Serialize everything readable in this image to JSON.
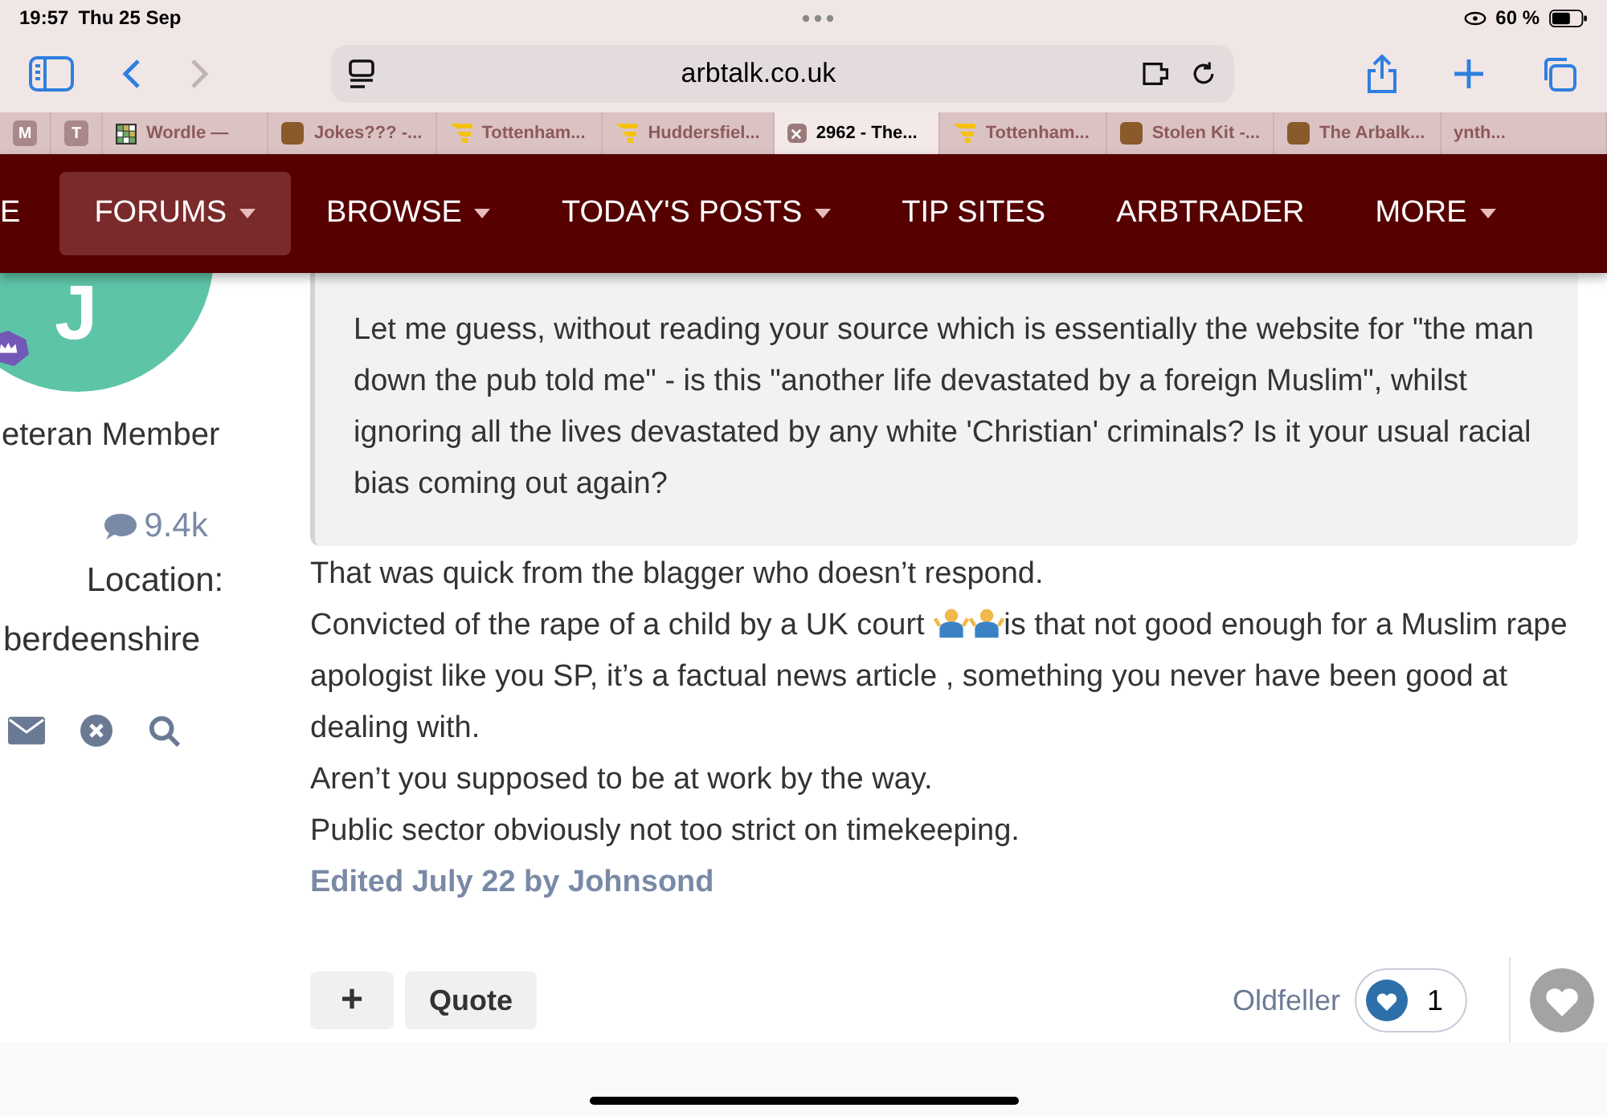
{
  "status_bar": {
    "time": "19:57",
    "date": "Thu 25 Sep",
    "battery": "60 %"
  },
  "browser": {
    "url": "arbtalk.co.uk"
  },
  "tabs": [
    {
      "kind": "letter",
      "letter": "M",
      "selected": false
    },
    {
      "kind": "letter",
      "letter": "T",
      "selected": false
    },
    {
      "kind": "grid",
      "label": "Wordle —",
      "selected": false
    },
    {
      "kind": "avatar",
      "label": "Jokes??? -...",
      "selected": false
    },
    {
      "kind": "flag",
      "label": "Tottenham...",
      "selected": false
    },
    {
      "kind": "flag",
      "label": "Huddersfiel...",
      "selected": false
    },
    {
      "kind": "close",
      "label": "2962 - The...",
      "selected": true
    },
    {
      "kind": "flag",
      "label": "Tottenham...",
      "selected": false
    },
    {
      "kind": "avatar",
      "label": "Stolen Kit -...",
      "selected": false
    },
    {
      "kind": "avatar",
      "label": "The Arbalk...",
      "selected": false
    },
    {
      "kind": "plain",
      "label": "ynth...",
      "selected": false
    }
  ],
  "nav": [
    {
      "label": "E",
      "dropdown": false,
      "selected": false
    },
    {
      "label": "FORUMS",
      "dropdown": true,
      "selected": true
    },
    {
      "label": "BROWSE",
      "dropdown": true,
      "selected": false
    },
    {
      "label": "TODAY'S POSTS",
      "dropdown": true,
      "selected": false
    },
    {
      "label": "TIP SITES",
      "dropdown": false,
      "selected": false
    },
    {
      "label": "ARBTRADER",
      "dropdown": false,
      "selected": false
    },
    {
      "label": "MORE",
      "dropdown": true,
      "selected": false
    }
  ],
  "author": {
    "avatar_letter": "J",
    "rank": "eteran Member",
    "posts": "9.4k",
    "location_label": "Location:",
    "location": "berdeenshire"
  },
  "quote": "Let me guess, without reading your source which is essentially the website for \"the man down the pub told me\" - is this \"another life devastated by a foreign Muslim\", whilst ignoring all the lives devastated by any white 'Christian' criminals? Is it your usual racial bias coming out again?",
  "post_lines": [
    {
      "kind": "text",
      "text": "That was quick from the blagger who doesn’t  respond."
    },
    {
      "kind": "emoji",
      "before": "Convicted of the rape of a child by a UK court",
      "after": "is that not good enough for a Muslim rape apologist  like you SP, it’s a factual news article , something you never have been good at dealing with."
    },
    {
      "kind": "text",
      "text": "Aren’t you supposed to be at work by the way."
    },
    {
      "kind": "text",
      "text": "Public sector obviously not too strict on timekeeping."
    }
  ],
  "edited": "Edited July 22 by Johnsond",
  "actions": {
    "plus": "+",
    "quote": "Quote",
    "liked_by": "Oldfeller",
    "like_count": "1"
  }
}
